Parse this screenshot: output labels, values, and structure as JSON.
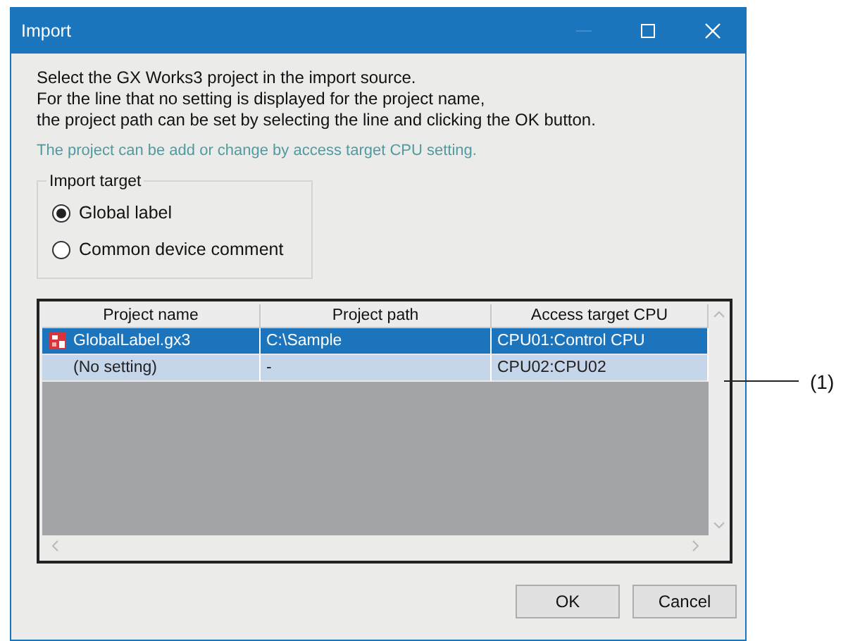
{
  "window": {
    "title": "Import",
    "controls": [
      {
        "kind": "minimize",
        "disabled": true
      },
      {
        "kind": "maximize",
        "disabled": false
      },
      {
        "kind": "close",
        "disabled": false
      }
    ]
  },
  "instructions": [
    "Select the GX Works3 project in the import source.",
    "For the line that no setting is displayed for the project name,",
    "the project path can be set by selecting the line and clicking the OK button."
  ],
  "note": "The project can be add or change by access target CPU setting.",
  "import_target": {
    "label": "Import target",
    "options": [
      {
        "label": "Global label",
        "selected": true
      },
      {
        "label": "Common device comment",
        "selected": false
      }
    ]
  },
  "table": {
    "columns": [
      "Project name",
      "Project path",
      "Access target CPU"
    ],
    "rows": [
      {
        "selected": true,
        "has_icon": true,
        "cells": [
          "GlobalLabel.gx3",
          "C:\\Sample",
          "CPU01:Control CPU"
        ]
      },
      {
        "selected": false,
        "has_icon": false,
        "cells": [
          "(No setting)",
          "-",
          "CPU02:CPU02"
        ]
      }
    ]
  },
  "buttons": [
    "OK",
    "Cancel"
  ],
  "callout": "(1)"
}
